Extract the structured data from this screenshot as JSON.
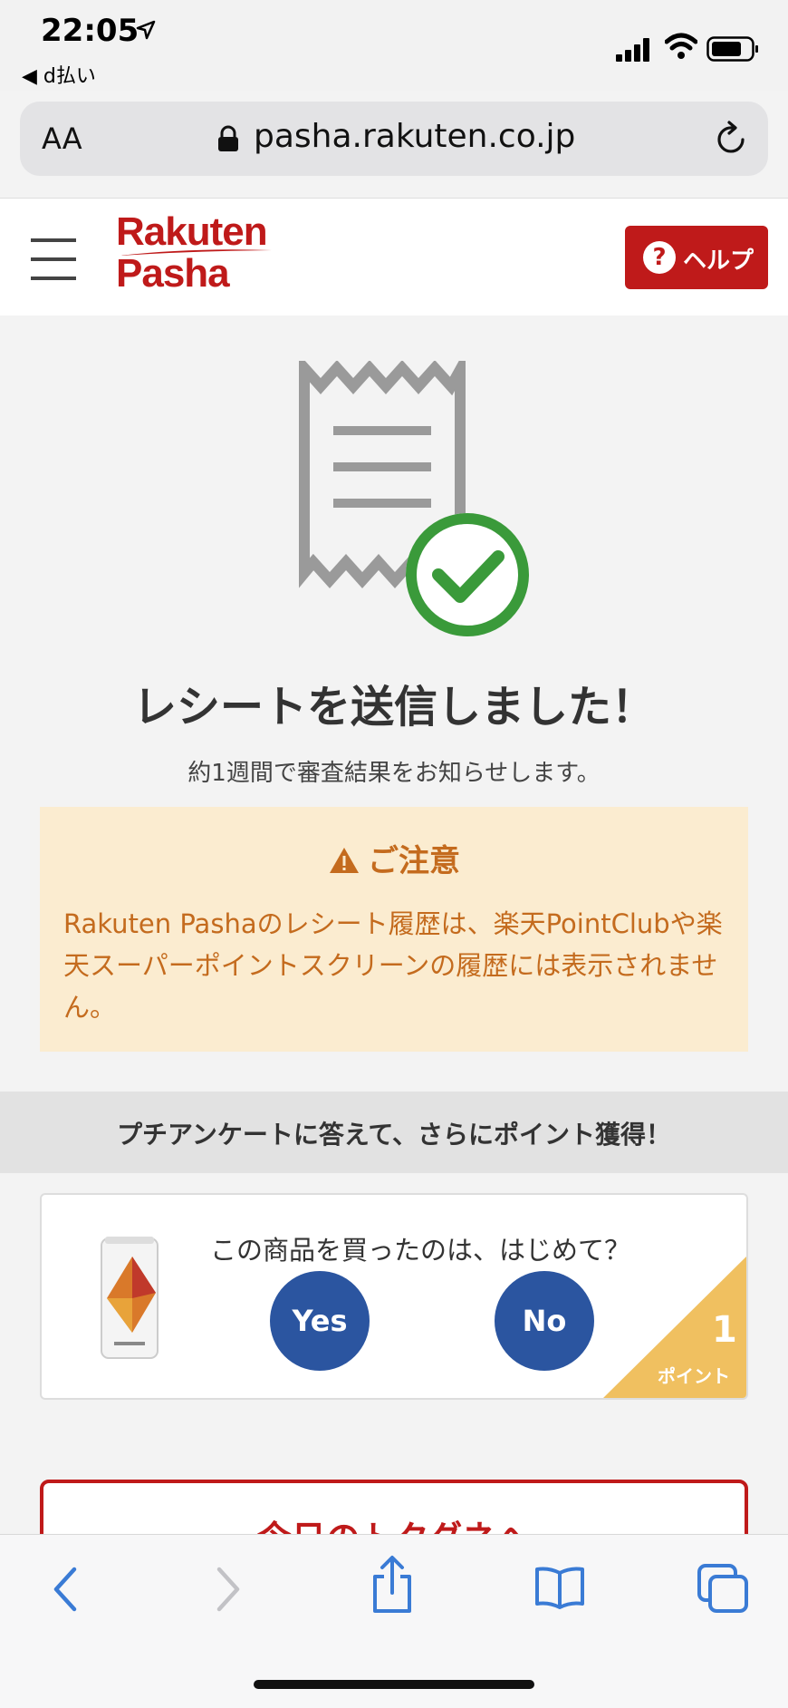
{
  "status_bar": {
    "time": "22:05",
    "back_app": "◀ d払い"
  },
  "url_bar": {
    "text_size_label": "AA",
    "url": "pasha.rakuten.co.jp"
  },
  "header": {
    "logo_line1": "Rakuten",
    "logo_line2": "Pasha",
    "help_label": "ヘルプ",
    "help_icon": "?"
  },
  "main": {
    "title": "レシートを送信しました！",
    "subtitle": "約1週間で審査結果をお知らせします。"
  },
  "notice": {
    "title": "ご注意",
    "body": "Rakuten Pashaのレシート履歴は、楽天PointClubや楽天スーパーポイントスクリーンの履歴には表示されません。"
  },
  "survey": {
    "band_text": "プチアンケートに答えて、さらにポイント獲得！",
    "question": "この商品を買ったのは、はじめて？",
    "yes_label": "Yes",
    "no_label": "No",
    "points": "1",
    "points_label": "ポイント"
  },
  "tokudane": {
    "label": "今日のトクダネへ"
  },
  "colors": {
    "brand_red": "#bf1a1a",
    "notice_bg": "#fbecd0",
    "notice_text": "#c46b1e",
    "button_blue": "#2b55a0",
    "check_green": "#3a9a3a",
    "point_yellow": "#f0c060",
    "safari_blue": "#3a7bd5"
  }
}
